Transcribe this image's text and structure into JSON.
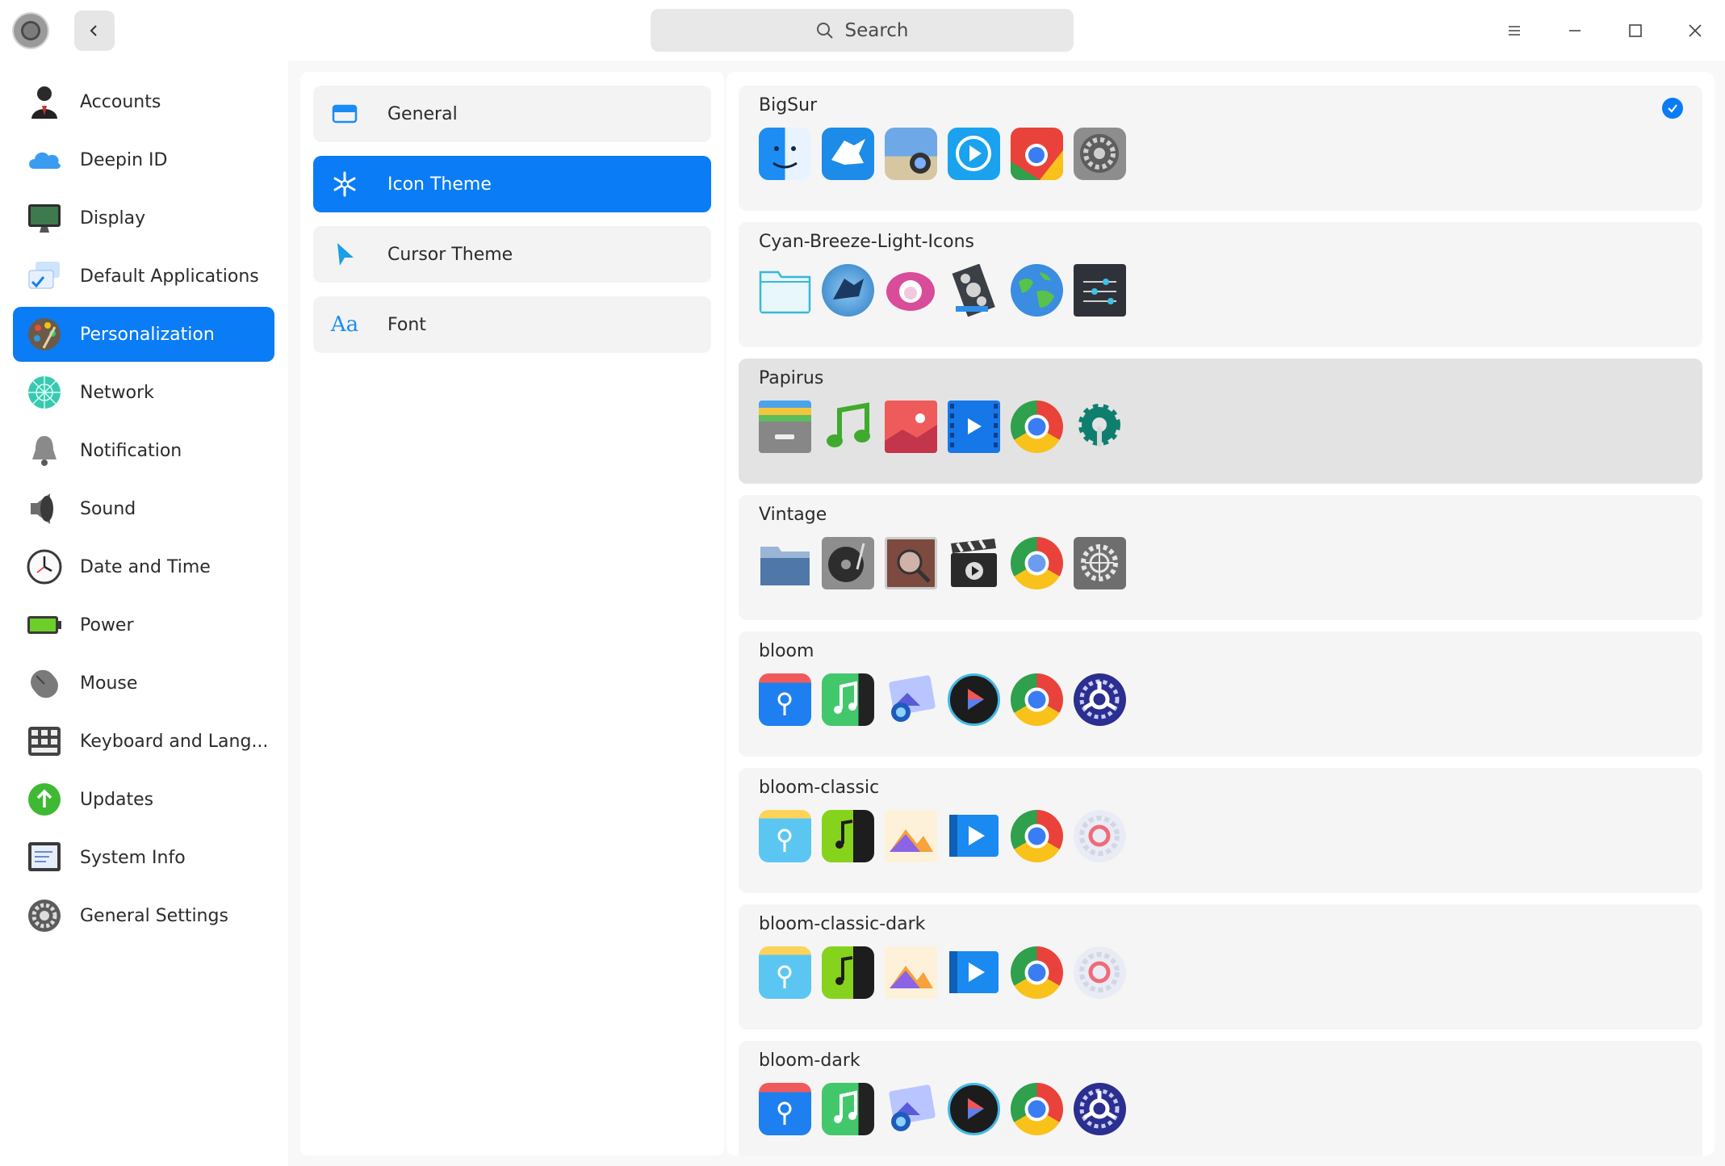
{
  "search": {
    "placeholder": "Search"
  },
  "sidebar": {
    "items": [
      {
        "label": "Accounts",
        "icon": "accounts-icon"
      },
      {
        "label": "Deepin ID",
        "icon": "cloud-icon"
      },
      {
        "label": "Display",
        "icon": "display-icon"
      },
      {
        "label": "Default Applications",
        "icon": "default-apps-icon"
      },
      {
        "label": "Personalization",
        "icon": "palette-icon",
        "active": true
      },
      {
        "label": "Network",
        "icon": "network-icon"
      },
      {
        "label": "Notification",
        "icon": "bell-icon"
      },
      {
        "label": "Sound",
        "icon": "speaker-icon"
      },
      {
        "label": "Date and Time",
        "icon": "clock-icon"
      },
      {
        "label": "Power",
        "icon": "battery-icon"
      },
      {
        "label": "Mouse",
        "icon": "mouse-icon"
      },
      {
        "label": "Keyboard and Lang...",
        "icon": "keyboard-icon"
      },
      {
        "label": "Updates",
        "icon": "update-arrow-icon"
      },
      {
        "label": "System Info",
        "icon": "system-info-icon"
      },
      {
        "label": "General Settings",
        "icon": "gear-icon"
      }
    ]
  },
  "submenu": {
    "items": [
      {
        "label": "General",
        "icon": "window-icon"
      },
      {
        "label": "Icon Theme",
        "icon": "snowflake-icon",
        "active": true
      },
      {
        "label": "Cursor Theme",
        "icon": "cursor-icon"
      },
      {
        "label": "Font",
        "icon": "font-icon",
        "glyph": "Aa"
      }
    ]
  },
  "themes": [
    {
      "name": "BigSur",
      "selected": true
    },
    {
      "name": "Cyan-Breeze-Light-Icons"
    },
    {
      "name": "Papirus",
      "hover": true
    },
    {
      "name": "Vintage"
    },
    {
      "name": "bloom"
    },
    {
      "name": "bloom-classic"
    },
    {
      "name": "bloom-classic-dark"
    },
    {
      "name": "bloom-dark"
    }
  ],
  "colors": {
    "accent": "#0a7cf5",
    "window": "#ffffff",
    "panel": "#f8f8f8"
  }
}
